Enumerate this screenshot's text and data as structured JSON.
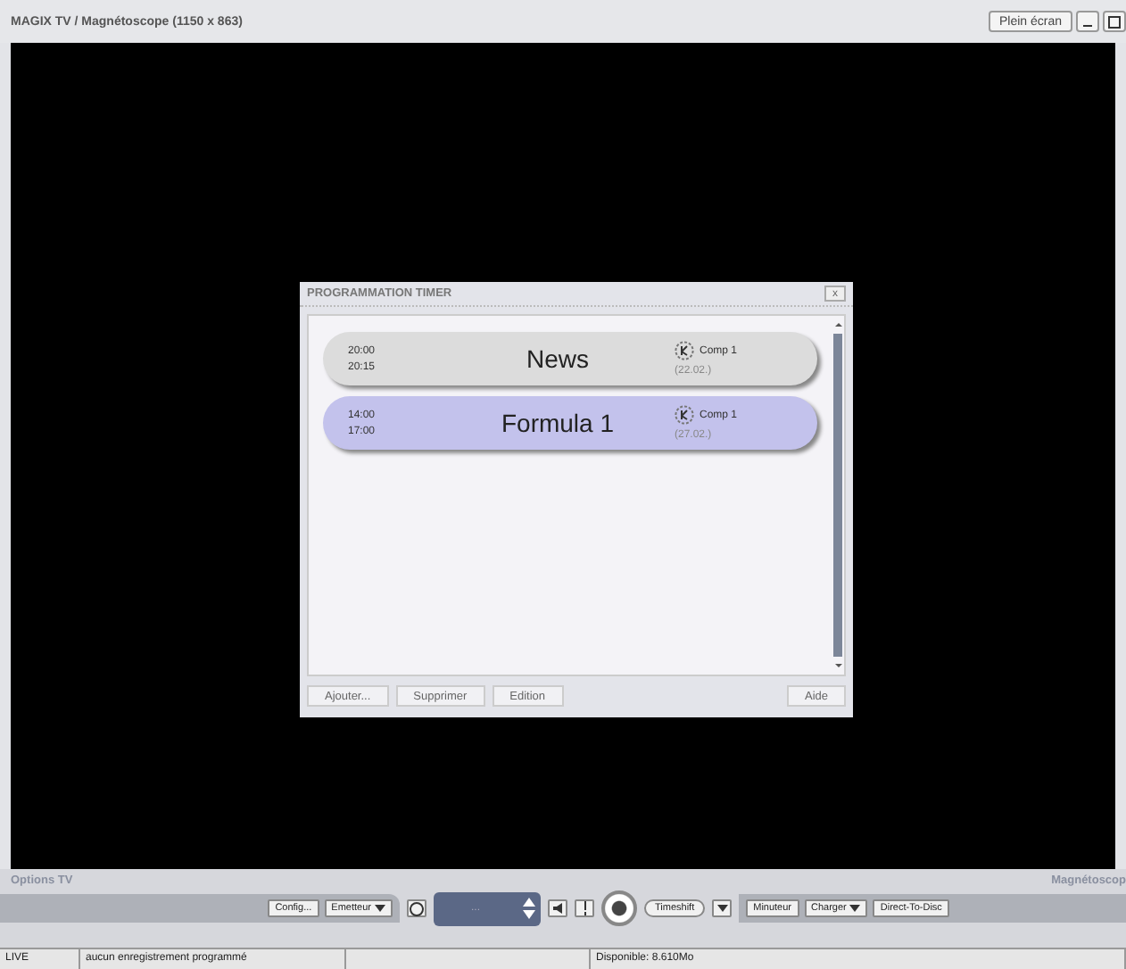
{
  "window": {
    "title": "MAGIX TV / Magnétoscope (1150 x 863)",
    "fullscreen_button": "Plein écran"
  },
  "dialog": {
    "title": "PROGRAMMATION TIMER",
    "close": "x",
    "entries": [
      {
        "start": "20:00",
        "end": "20:15",
        "name": "News",
        "channel": "Comp 1",
        "date": "(22.02.)",
        "selected": false
      },
      {
        "start": "14:00",
        "end": "17:00",
        "name": "Formula 1",
        "channel": "Comp 1",
        "date": "(27.02.)",
        "selected": true
      }
    ],
    "buttons": [
      "Ajouter...",
      "Supprimer",
      "Edition"
    ],
    "help_button": "Aide"
  },
  "panel": {
    "left_label": "Options TV",
    "right_label": "Magnétoscop",
    "left_buttons": [
      {
        "label": "Config...",
        "dropdown": false
      },
      {
        "label": "Emetteur",
        "dropdown": true
      }
    ],
    "channel_display": "...",
    "timeshift": "Timeshift",
    "right_buttons": [
      {
        "label": "Minuteur",
        "dropdown": false
      },
      {
        "label": "Charger",
        "dropdown": true
      },
      {
        "label": "Direct-To-Disc",
        "dropdown": false
      }
    ]
  },
  "status_bar": [
    "LIVE",
    "aucun enregistrement programmé",
    "Disponible: 8.610Mo"
  ]
}
